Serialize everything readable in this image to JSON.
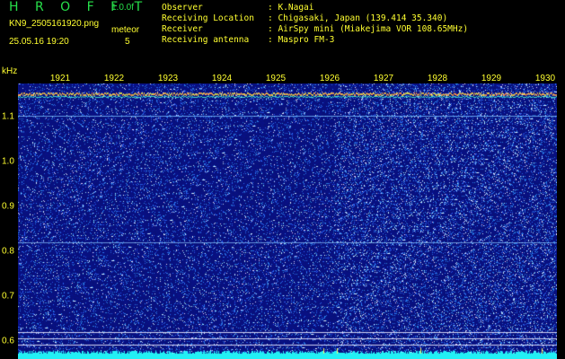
{
  "header": {
    "app_title": "H R O F F T",
    "version": "1.0.0f",
    "filename": "KN9_2505161920.png",
    "meteor_label": "meteor",
    "datetime": "25.05.16 19:20",
    "meteor_count": "5"
  },
  "info": [
    {
      "key": "Observer",
      "value": ": K.Nagai"
    },
    {
      "key": "Receiving Location",
      "value": ": Chigasaki, Japan (139.414 35.340)"
    },
    {
      "key": "Receiver",
      "value": ": AirSpy mini (Miakejima VOR 108.65MHz)"
    },
    {
      "key": "Receiving antenna",
      "value": ": Maspro FM-3"
    }
  ],
  "axis": {
    "y_unit": "kHz",
    "x_ticks": [
      "1921",
      "1922",
      "1923",
      "1924",
      "1925",
      "1926",
      "1927",
      "1928",
      "1929",
      "1930"
    ],
    "y_ticks": [
      "1.1",
      "1.0",
      "0.9",
      "0.8",
      "0.7",
      "0.6"
    ]
  },
  "colors": {
    "label": "#ffff30",
    "title": "#27e04a",
    "background": "#0a1380"
  }
}
